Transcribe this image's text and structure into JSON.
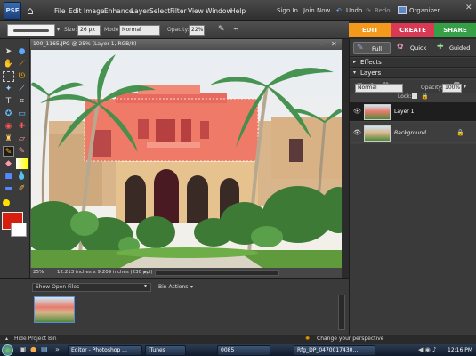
{
  "app": {
    "logo_text": "PSE"
  },
  "menu": [
    "File",
    "Edit",
    "Image",
    "Enhance",
    "Layer",
    "Select",
    "Filter",
    "View",
    "Window",
    "Help"
  ],
  "topright": {
    "sign_in": "Sign In",
    "join_now": "Join Now",
    "undo": "Undo",
    "redo": "Redo",
    "organizer": "Organizer"
  },
  "options": {
    "size_label": "Size:",
    "size_value": "26 px",
    "mode_label": "Mode:",
    "mode_value": "Normal",
    "opacity_label": "Opacity:",
    "opacity_value": "22%"
  },
  "tabs": {
    "edit": "EDIT",
    "create": "CREATE",
    "share": "SHARE"
  },
  "edit_modes": {
    "full": "Full",
    "quick": "Quick",
    "guided": "Guided"
  },
  "document": {
    "title": "100_1165.JPG @ 25% (Layer 1, RGB/8)",
    "zoom": "25%",
    "dimensions": "12.213 inches x 9.209 inches (230 ppi)"
  },
  "panels": {
    "effects": "Effects",
    "layers": "Layers"
  },
  "layers_panel": {
    "blend_mode": "Normal",
    "opacity_label": "Opacity:",
    "opacity_value": "100%",
    "lock_label": "Lock:",
    "layers": [
      {
        "name": "Layer 1"
      },
      {
        "name": "Background"
      }
    ]
  },
  "bin": {
    "show_files": "Show Open Files",
    "actions": "Bin Actions",
    "hide": "Hide Project Bin"
  },
  "status": {
    "hint": "Change your perspective"
  },
  "taskbar": {
    "items": [
      "Editor - Photoshop ...",
      "iTunes",
      "0085",
      "Rfg_DP_0470017430..."
    ],
    "clock": "12:16 PM"
  },
  "colors": {
    "edit_tab": "#f39a1c",
    "create_tab": "#d83a55",
    "share_tab": "#36a046",
    "selection_tint": "#ff6a6a"
  }
}
